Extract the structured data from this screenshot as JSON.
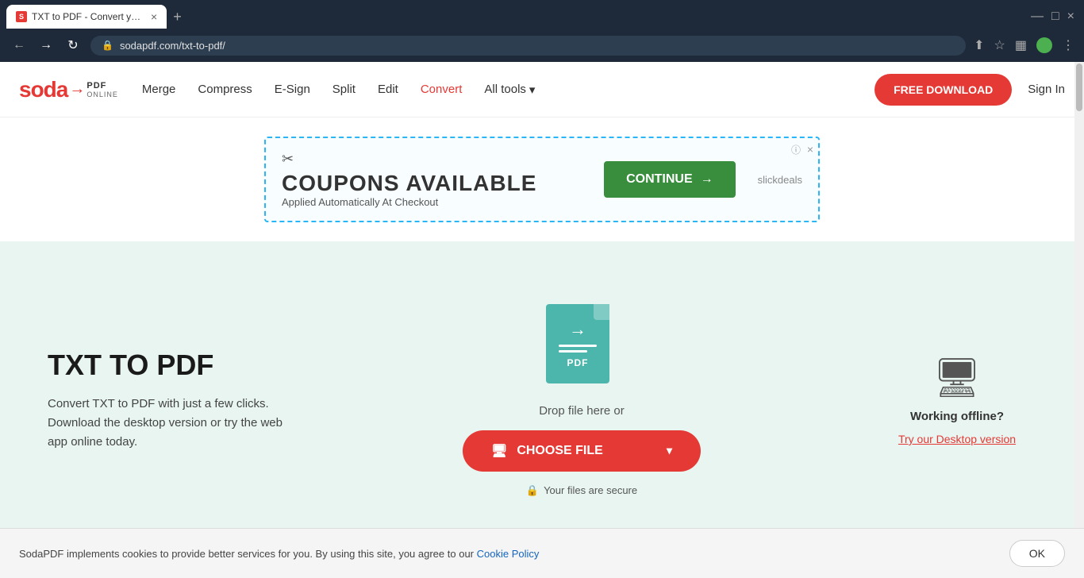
{
  "browser": {
    "tab_favicon": "S",
    "tab_title": "TXT to PDF - Convert your TXT t...",
    "tab_close": "×",
    "new_tab": "+",
    "win_controls": [
      "—",
      "□",
      "×"
    ],
    "nav_back": "←",
    "nav_forward": "→",
    "nav_refresh": "↻",
    "url": "sodapdf.com/txt-to-pdf/",
    "lock": "🔒"
  },
  "navbar": {
    "logo_soda": "soda",
    "logo_pdf": "PDF",
    "logo_online": "ONLINE",
    "links": [
      "Merge",
      "Compress",
      "E-Sign",
      "Split",
      "Edit",
      "Convert",
      "All tools"
    ],
    "free_download": "FREE DOWNLOAD",
    "sign_in": "Sign In"
  },
  "ad": {
    "scissors": "✂",
    "title": "COUPONS AVAILABLE",
    "subtitle": "Applied Automatically At Checkout",
    "continue": "CONTINUE",
    "arrow": "→",
    "slickdeals": "slickdeals",
    "close": "×",
    "info": "ⓘ"
  },
  "main": {
    "title": "TXT TO PDF",
    "description": "Convert TXT to PDF with just a few clicks. Download the desktop version or try the web app online today.",
    "drop_text": "Drop file here or",
    "choose_file": "CHOOSE FILE",
    "secure_text": "Your files are secure",
    "offline_title": "Working offline?",
    "desktop_link": "Try our Desktop version"
  },
  "cookie": {
    "text": "SodaPDF implements cookies to provide better services for you. By using this site, you agree to our",
    "link_text": "Cookie Policy",
    "ok": "OK"
  }
}
